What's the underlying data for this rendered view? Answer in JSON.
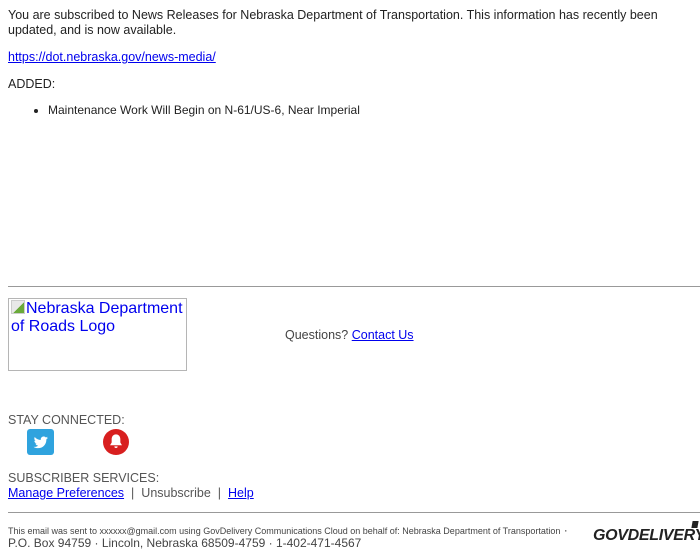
{
  "email": {
    "intro": "You are subscribed to News Releases for Nebraska Department of Transportation. This information has recently been updated, and is now available.",
    "url": "https://dot.nebraska.gov/news-media/",
    "added_label": "ADDED:",
    "items": [
      "Maintenance Work Will Begin on N-61/US-6, Near Imperial"
    ]
  },
  "footer": {
    "logo_alt": "Nebraska Department of Roads Logo",
    "questions_label": "Questions?",
    "contact_link": "Contact Us",
    "stay_connected": "STAY CONNECTED:",
    "social": [
      {
        "name": "twitter",
        "icon": "twitter-icon",
        "color": "#2fa3de"
      },
      {
        "name": "alerts",
        "icon": "bell-icon",
        "color": "#d81f1f"
      }
    ],
    "subscriber_services": "SUBSCRIBER SERVICES:",
    "manage_preferences": "Manage Preferences",
    "separator": "|",
    "unsubscribe": "Unsubscribe",
    "help": "Help",
    "sent_text": "This email was sent to xxxxxx@gmail.com using GovDelivery Communications Cloud on behalf of: Nebraska Department of Transportation",
    "address": " · P.O. Box 94759 · Lincoln, Nebraska 68509-4759 · 1-402-471-4567",
    "brand": "GOVDELIVERY"
  }
}
